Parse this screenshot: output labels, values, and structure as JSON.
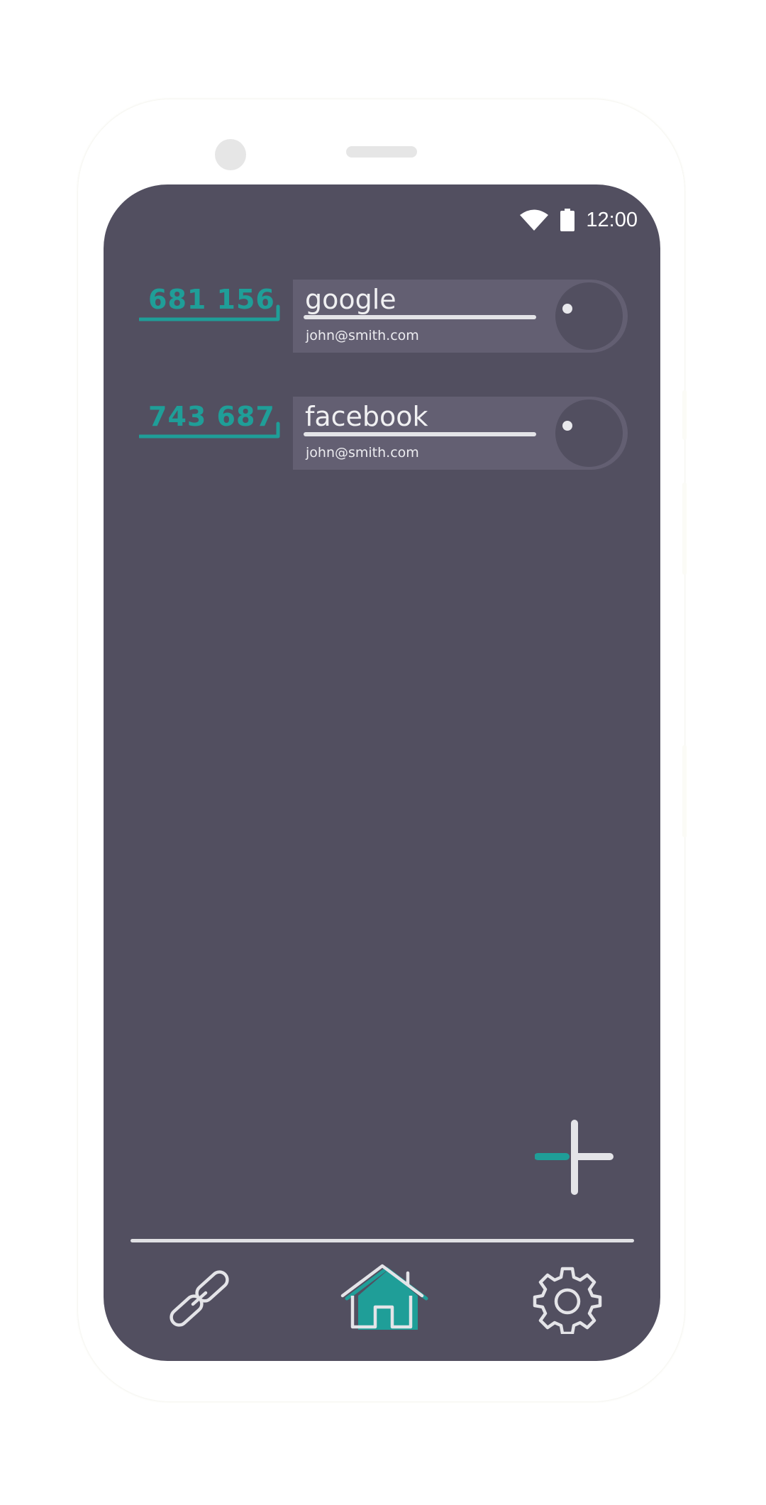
{
  "status_bar": {
    "time": "12:00"
  },
  "accounts": [
    {
      "code": "681 156",
      "service": "google",
      "account": "john@smith.com"
    },
    {
      "code": "743 687",
      "service": "facebook",
      "account": "john@smith.com"
    }
  ],
  "nav": {
    "items": [
      {
        "name": "links",
        "icon": "link-icon"
      },
      {
        "name": "home",
        "icon": "home-icon",
        "active": true
      },
      {
        "name": "settings",
        "icon": "gear-icon"
      }
    ]
  },
  "colors": {
    "screen_bg": "#524f60",
    "card_bg": "#635f72",
    "accent": "#1f9e98",
    "foreground": "#e4e4e8"
  }
}
